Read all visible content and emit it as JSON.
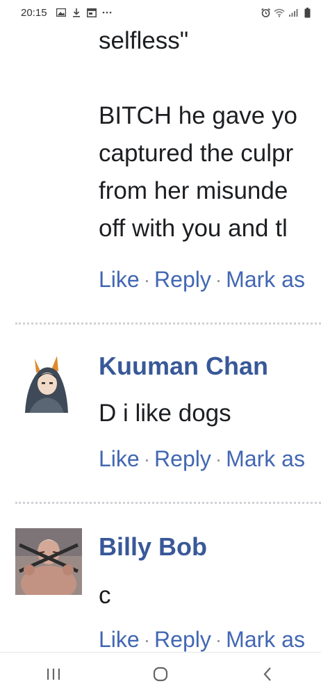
{
  "status_bar": {
    "time": "20:15",
    "left_icons": [
      "image-icon",
      "download-icon",
      "calendar-icon",
      "more-icon"
    ],
    "right_icons": [
      "alarm-icon",
      "wifi-icon",
      "signal-icon",
      "battery-icon"
    ]
  },
  "comments": [
    {
      "text_lines": [
        "selfless\"",
        "",
        "BITCH he gave yo",
        "captured the culpr",
        "from her misunde",
        "off with you and tl"
      ],
      "actions": {
        "like": "Like",
        "reply": "Reply",
        "mark": "Mark as"
      }
    },
    {
      "author": "Kuuman Chan",
      "text_lines": [
        "D i like dogs"
      ],
      "actions": {
        "like": "Like",
        "reply": "Reply",
        "mark": "Mark as"
      }
    },
    {
      "author": "Billy Bob",
      "text_lines": [
        "c"
      ],
      "actions": {
        "like": "Like",
        "reply": "Reply",
        "mark": "Mark as"
      }
    }
  ],
  "separator": "·",
  "nav_bar": {
    "buttons": [
      "recent-apps-icon",
      "home-icon",
      "back-icon"
    ]
  },
  "colors": {
    "link": "#4267b2",
    "author": "#385898",
    "text": "#1c1e21"
  }
}
